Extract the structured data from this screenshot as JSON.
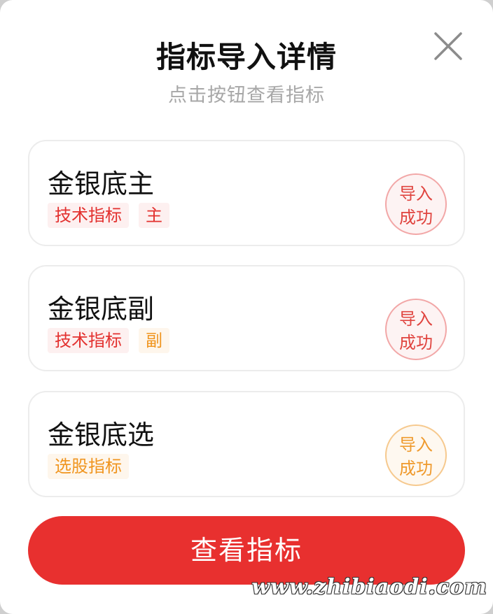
{
  "dialog": {
    "title": "指标导入详情",
    "subtitle": "点击按钮查看指标",
    "close_icon": "close-icon"
  },
  "items": [
    {
      "name": "金银底主",
      "tags": [
        {
          "label": "技术指标",
          "color": "#e3312f"
        },
        {
          "label": "主",
          "color": "#e3312f"
        }
      ],
      "status_line1": "导入",
      "status_line2": "成功",
      "status_color": "#e0443f"
    },
    {
      "name": "金银底副",
      "tags": [
        {
          "label": "技术指标",
          "color": "#e3312f"
        },
        {
          "label": "副",
          "color": "#f0951f"
        }
      ],
      "status_line1": "导入",
      "status_line2": "成功",
      "status_color": "#e0443f"
    },
    {
      "name": "金银底选",
      "tags": [
        {
          "label": "选股指标",
          "color": "#f0951f"
        }
      ],
      "status_line1": "导入",
      "status_line2": "成功",
      "status_color": "#ef9a2d"
    }
  ],
  "action": {
    "label": "查看指标",
    "color": "#e8302f"
  },
  "watermark": "www.zhibiaodi.com"
}
